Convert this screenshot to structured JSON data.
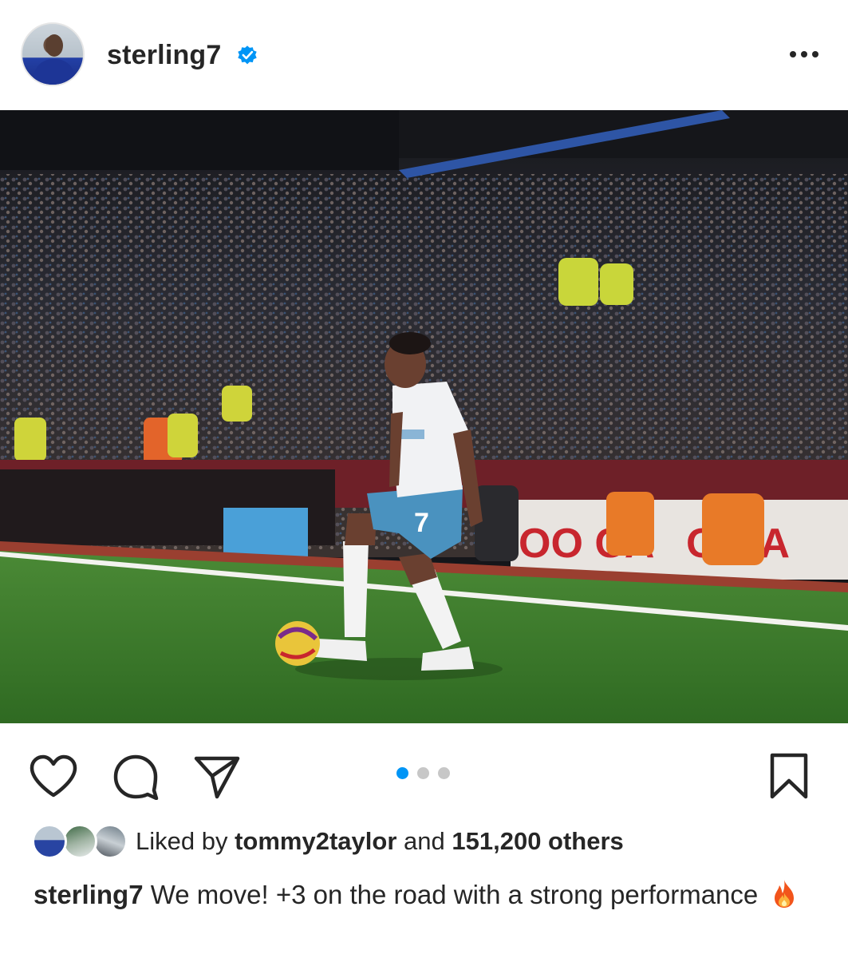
{
  "post": {
    "username": "sterling7",
    "verified": true,
    "more_icon": "more-horizontal-icon",
    "avatar_icon": "profile-avatar",
    "carousel": {
      "count": 3,
      "active_index": 0
    },
    "actions": {
      "like_icon": "heart-outline-icon",
      "comment_icon": "comment-bubble-icon",
      "share_icon": "paper-plane-icon",
      "save_icon": "bookmark-outline-icon"
    },
    "likes": {
      "prefix": "Liked by",
      "user": "tommy2taylor",
      "conjunction": "and",
      "others": "151,200 others"
    },
    "caption": {
      "username": "sterling7",
      "text": "We move! +3 on the road with a strong performance",
      "emoji_icon": "fire-emoji-icon"
    },
    "photo_jersey_number": "7"
  },
  "colors": {
    "accent_blue": "#0095f6",
    "text": "#262626",
    "inactive_dot": "#c7c7c7",
    "pitch_green": "#3d7a2c"
  }
}
